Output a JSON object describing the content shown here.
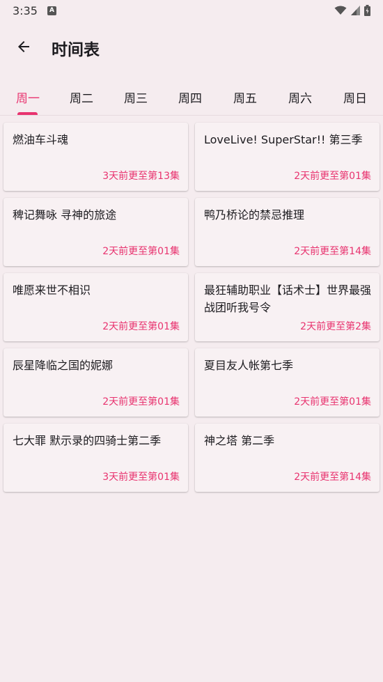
{
  "status_bar": {
    "time": "3:35",
    "notification_glyph": "A"
  },
  "app_bar": {
    "title": "时间表"
  },
  "tabs": [
    "周一",
    "周二",
    "周三",
    "周四",
    "周五",
    "周六",
    "周日"
  ],
  "active_tab": "周一",
  "accent_color": "#e8336f",
  "cards": [
    {
      "title": "燃油车斗魂",
      "update": "3天前更至第13集"
    },
    {
      "title": "LoveLive! SuperStar!! 第三季",
      "update": "2天前更至第01集"
    },
    {
      "title": "稗记舞咏 寻神的旅途",
      "update": "2天前更至第01集"
    },
    {
      "title": "鸭乃桥论的禁忌推理",
      "update": "2天前更至第14集"
    },
    {
      "title": "唯愿来世不相识",
      "update": "2天前更至第01集"
    },
    {
      "title": "最狂辅助职业【话术士】世界最强战团听我号令",
      "update": "2天前更至第2集"
    },
    {
      "title": "辰星降临之国的妮娜",
      "update": "2天前更至第01集"
    },
    {
      "title": "夏目友人帐第七季",
      "update": "2天前更至第01集"
    },
    {
      "title": "七大罪 默示录的四骑士第二季",
      "update": "3天前更至第01集"
    },
    {
      "title": "神之塔 第二季",
      "update": "2天前更至第14集"
    }
  ]
}
